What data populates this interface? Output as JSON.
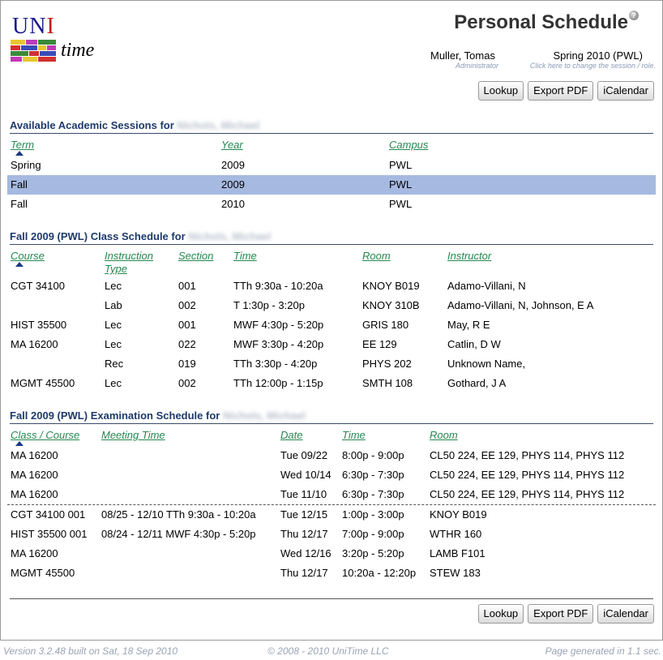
{
  "header": {
    "logo_uni_a": "UN",
    "logo_uni_b": "I",
    "logo_time": "time",
    "title": "Personal Schedule",
    "help_glyph": "?",
    "user_name": "Muller, Tomas",
    "user_role": "Administrator",
    "session": "Spring 2010 (PWL)",
    "session_hint": "Click here to change the session / role."
  },
  "buttons": {
    "lookup": "Lookup",
    "export_pdf": "Export PDF",
    "icalendar": "iCalendar"
  },
  "sessions": {
    "title": "Available Academic Sessions for",
    "person": "Nichols, Michael",
    "columns": [
      "Term",
      "Year",
      "Campus"
    ],
    "rows": [
      {
        "term": "Spring",
        "year": "2009",
        "campus": "PWL",
        "selected": false
      },
      {
        "term": "Fall",
        "year": "2009",
        "campus": "PWL",
        "selected": true
      },
      {
        "term": "Fall",
        "year": "2010",
        "campus": "PWL",
        "selected": false
      }
    ],
    "selected_color": "#a6b9e0"
  },
  "classes": {
    "title": "Fall 2009 (PWL) Class Schedule for",
    "person": "Nichols, Michael",
    "columns": [
      "Course",
      "Instruction",
      "Type",
      "Section",
      "Time",
      "Room",
      "Instructor"
    ],
    "rows": [
      {
        "course": "CGT 34100",
        "type": "Lec",
        "section": "001",
        "time": "TTh 9:30a - 10:20a",
        "room": "KNOY B019",
        "instructor": "Adamo-Villani, N"
      },
      {
        "course": "",
        "type": "Lab",
        "section": "002",
        "time": "T 1:30p - 3:20p",
        "room": "KNOY 310B",
        "instructor": "Adamo-Villani, N, Johnson, E A"
      },
      {
        "course": "HIST 35500",
        "type": "Lec",
        "section": "001",
        "time": "MWF 4:30p - 5:20p",
        "room": "GRIS 180",
        "instructor": "May, R E"
      },
      {
        "course": "MA 16200",
        "type": "Lec",
        "section": "022",
        "time": "MWF 3:30p - 4:20p",
        "room": "EE 129",
        "instructor": "Catlin, D W"
      },
      {
        "course": "",
        "type": "Rec",
        "section": "019",
        "time": "TTh 3:30p - 4:20p",
        "room": "PHYS 202",
        "instructor": "Unknown Name,"
      },
      {
        "course": "MGMT 45500",
        "type": "Lec",
        "section": "002",
        "time": "TTh 12:00p - 1:15p",
        "room": "SMTH 108",
        "instructor": "Gothard, J A"
      }
    ]
  },
  "exams": {
    "title": "Fall 2009 (PWL) Examination Schedule for",
    "person": "Nichols, Michael",
    "columns": [
      "Class / Course",
      "Meeting Time",
      "Date",
      "Time",
      "Room"
    ],
    "rows": [
      {
        "course": "MA 16200",
        "meeting": "",
        "date": "Tue 09/22",
        "time": "8:00p - 9:00p",
        "room": "CL50 224, EE 129, PHYS 114, PHYS 112"
      },
      {
        "course": "MA 16200",
        "meeting": "",
        "date": "Wed 10/14",
        "time": "6:30p - 7:30p",
        "room": "CL50 224, EE 129, PHYS 114, PHYS 112"
      },
      {
        "course": "MA 16200",
        "meeting": "",
        "date": "Tue 11/10",
        "time": "6:30p - 7:30p",
        "room": "CL50 224, EE 129, PHYS 114, PHYS 112"
      },
      {
        "course": "CGT 34100 001",
        "meeting": "08/25 - 12/10 TTh 9:30a - 10:20a",
        "date": "Tue 12/15",
        "time": "1:00p - 3:00p",
        "room": "KNOY B019"
      },
      {
        "course": "HIST 35500 001",
        "meeting": "08/24 - 12/11 MWF 4:30p - 5:20p",
        "date": "Thu 12/17",
        "time": "7:00p - 9:00p",
        "room": "WTHR 160"
      },
      {
        "course": "MA 16200",
        "meeting": "",
        "date": "Wed 12/16",
        "time": "3:20p - 5:20p",
        "room": "LAMB F101"
      },
      {
        "course": "MGMT 45500",
        "meeting": "",
        "date": "Thu 12/17",
        "time": "10:20a - 12:20p",
        "room": "STEW 183"
      }
    ]
  },
  "footer": {
    "version": "Version 3.2.48 built on Sat, 18 Sep 2010",
    "copyright": "© 2008 - 2010 UniTime LLC",
    "generated": "Page generated in 1.1 sec."
  },
  "colors": {
    "header_link": "#25874f",
    "section_title": "#1e3a6a",
    "hint": "#8a9bb8"
  }
}
